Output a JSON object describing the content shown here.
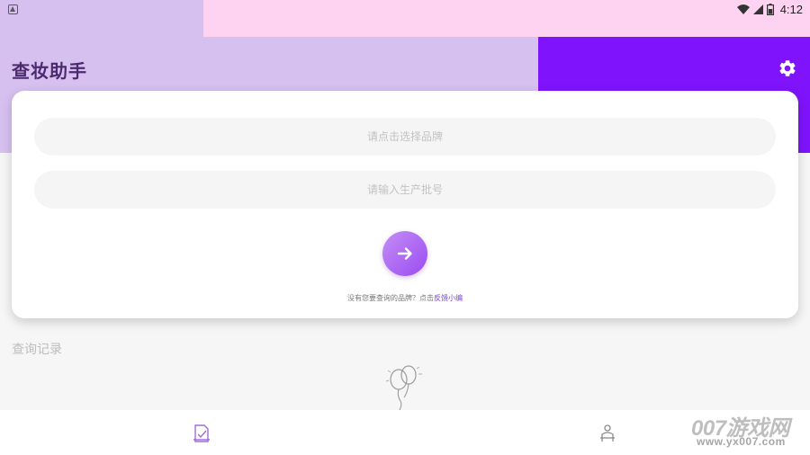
{
  "status_bar": {
    "time": "4:12",
    "icons": [
      "notification-icon",
      "wifi-icon",
      "signal-icon",
      "battery-icon"
    ]
  },
  "app_bar": {
    "title": "查妆助手",
    "settings_icon": "gear-icon"
  },
  "query_card": {
    "brand_placeholder": "请点击选择品牌",
    "batch_placeholder": "请输入生产批号",
    "submit_icon": "arrow-right-icon",
    "feedback_text": "没有您要查询的品牌？点击",
    "feedback_link": "反馈小编"
  },
  "history": {
    "title": "查询记录",
    "empty_icon": "balloon-icon"
  },
  "bottom_nav": {
    "items": [
      {
        "name": "home",
        "icon": "check-document-icon"
      },
      {
        "name": "mine",
        "icon": "person-icon"
      }
    ]
  },
  "watermark": {
    "line1": "007游戏网",
    "line2": "www.yx007.com"
  },
  "colors": {
    "accent": "#7f13fb",
    "header_light": "#d6c0ef",
    "status_pink": "#fdd3f1",
    "link": "#7b3fd6"
  }
}
